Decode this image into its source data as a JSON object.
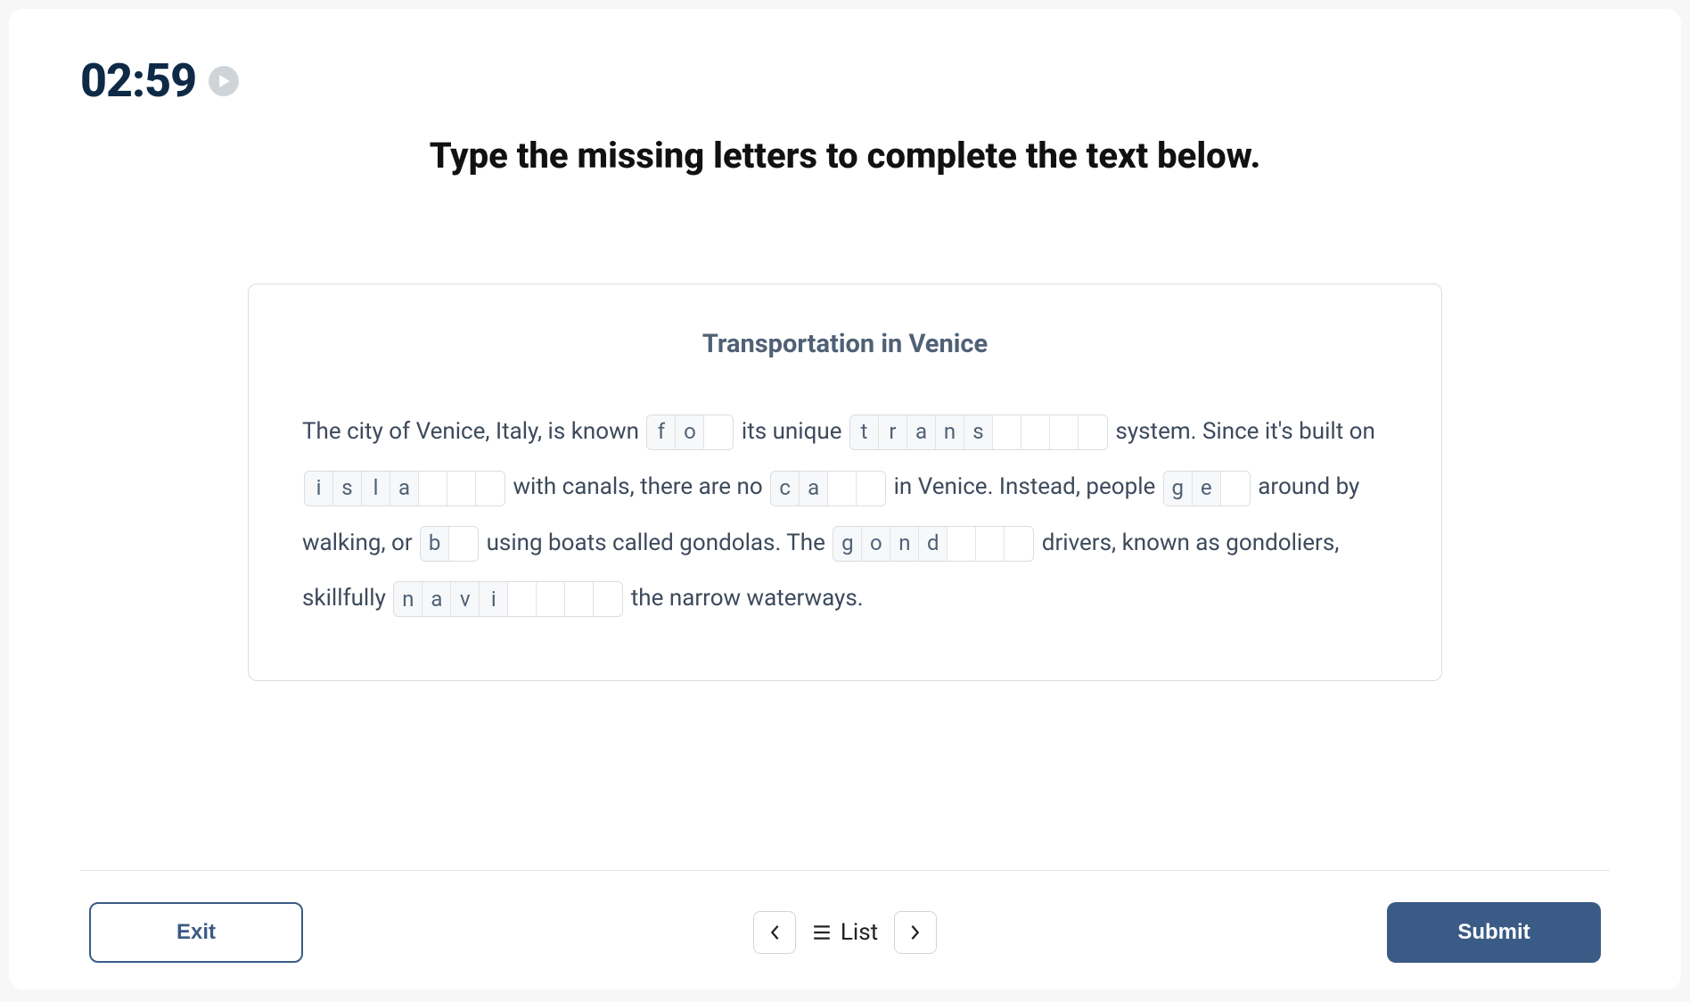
{
  "timer": "02:59",
  "instruction": "Type the missing letters to complete the text below.",
  "exercise": {
    "title": "Transportation in Venice",
    "segments": [
      {
        "type": "text",
        "value": "The city of Venice, Italy, is known "
      },
      {
        "type": "word",
        "letters": [
          "f",
          "o",
          ""
        ]
      },
      {
        "type": "text",
        "value": " its unique "
      },
      {
        "type": "word",
        "letters": [
          "t",
          "r",
          "a",
          "n",
          "s",
          "",
          "",
          "",
          ""
        ]
      },
      {
        "type": "text",
        "value": " system. Since it's built on "
      },
      {
        "type": "word",
        "letters": [
          "i",
          "s",
          "l",
          "a",
          "",
          "",
          ""
        ]
      },
      {
        "type": "text",
        "value": " with canals, there are no "
      },
      {
        "type": "word",
        "letters": [
          "c",
          "a",
          "",
          ""
        ]
      },
      {
        "type": "text",
        "value": " in Venice. Instead, people "
      },
      {
        "type": "word",
        "letters": [
          "g",
          "e",
          ""
        ]
      },
      {
        "type": "text",
        "value": " around by walking, or "
      },
      {
        "type": "word",
        "letters": [
          "b",
          ""
        ]
      },
      {
        "type": "text",
        "value": " using boats called gondolas. The "
      },
      {
        "type": "word",
        "letters": [
          "g",
          "o",
          "n",
          "d",
          "",
          "",
          ""
        ]
      },
      {
        "type": "text",
        "value": " drivers, known as gondoliers, skillfully "
      },
      {
        "type": "word",
        "letters": [
          "n",
          "a",
          "v",
          "i",
          "",
          "",
          "",
          ""
        ]
      },
      {
        "type": "text",
        "value": " the narrow waterways."
      }
    ]
  },
  "footer": {
    "exit_label": "Exit",
    "list_label": "List",
    "submit_label": "Submit"
  }
}
